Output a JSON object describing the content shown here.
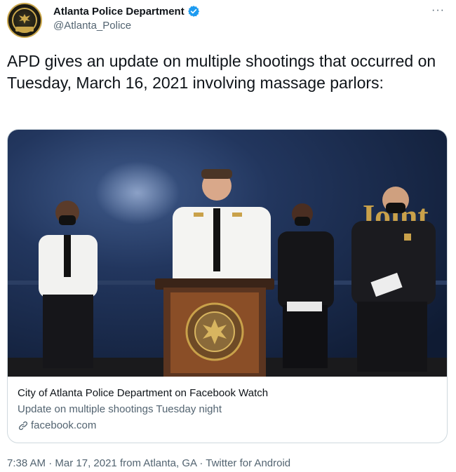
{
  "account": {
    "display_name": "Atlanta Police Department",
    "handle": "@Atlanta_Police",
    "avatar_icon": "atlanta-police-seal",
    "verified_color": "#1d9bf0"
  },
  "more_label": "···",
  "tweet": {
    "text": "APD gives an update on multiple shootings that occurred on Tuesday, March 16, 2021 involving massage parlors:"
  },
  "card": {
    "title": "City of Atlanta Police Department on Facebook Watch",
    "description": "Update on multiple shootings Tuesday night",
    "domain": "facebook.com",
    "image_alt": "Press conference with police chief at podium, officers and mayor standing beside",
    "wall_text": "Joint",
    "podium_seal_text": "CITY OF ATLANTA POLICE"
  },
  "meta": {
    "time": "7:38 AM",
    "date": "Mar 17, 2021",
    "location_prefix": "from",
    "location": "Atlanta, GA",
    "source": "Twitter for Android",
    "separator": " · "
  }
}
